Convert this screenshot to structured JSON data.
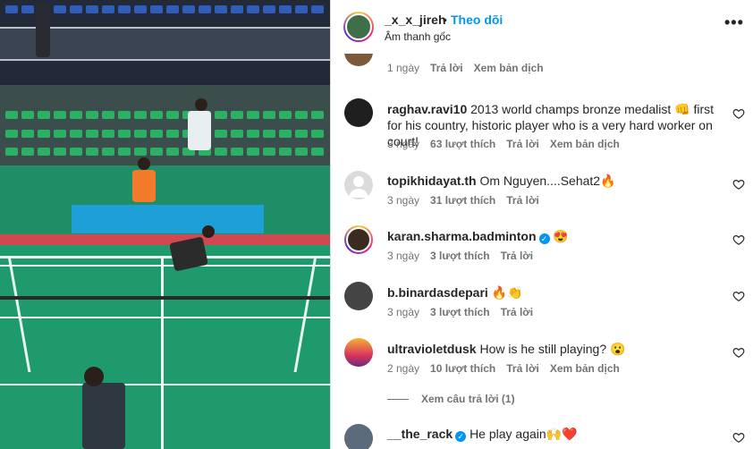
{
  "header": {
    "username": "_x_x_jireh",
    "separator": "•",
    "follow_label": "Theo dõi",
    "audio_label": "Âm thanh gốc",
    "more_icon": "more-horizontal-icon"
  },
  "colors": {
    "link_blue": "#0095f6",
    "meta_gray": "#737373",
    "text": "#262626",
    "court_green": "#1f9a6d"
  },
  "comments": [
    {
      "username": "",
      "text": "",
      "time": "1 ngày",
      "likes": "",
      "reply": "Trả lời",
      "translate": "Xem bản dịch"
    },
    {
      "username": "raghav.ravi10",
      "text": "2013 world champs bronze medalist 👊 first for his country, historic player who is a very hard worker on court!",
      "time": "3 ngày",
      "likes": "63 lượt thích",
      "reply": "Trả lời",
      "translate": "Xem bản dịch"
    },
    {
      "username": "topikhidayat.th",
      "text": "Om Nguyen....Sehat2🔥",
      "time": "3 ngày",
      "likes": "31 lượt thích",
      "reply": "Trả lời",
      "translate": ""
    },
    {
      "username": "karan.sharma.badminton",
      "text": "😍",
      "time": "3 ngày",
      "likes": "3 lượt thích",
      "reply": "Trả lời",
      "translate": ""
    },
    {
      "username": "b.binardasdepari",
      "text": "🔥👏",
      "time": "3 ngày",
      "likes": "3 lượt thích",
      "reply": "Trả lời",
      "translate": ""
    },
    {
      "username": "ultravioletdusk",
      "text": "How is he still playing? 😮",
      "time": "2 ngày",
      "likes": "10 lượt thích",
      "reply": "Trả lời",
      "translate": "Xem bản dịch"
    },
    {
      "username": "__the_rack",
      "text": "He play again🙌❤️",
      "time": "",
      "likes": "",
      "reply": "",
      "translate": ""
    }
  ],
  "view_replies": "Xem câu trả lời (1)"
}
